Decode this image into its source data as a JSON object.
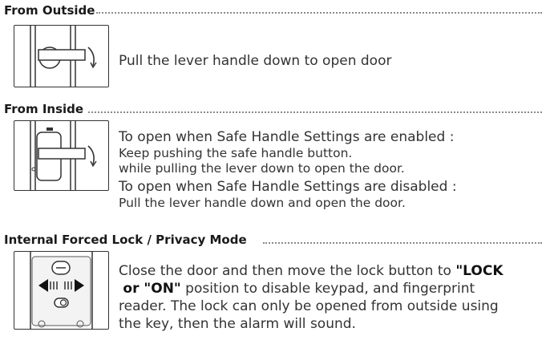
{
  "sections": [
    {
      "heading": "From Outside",
      "lines": [
        "Pull the lever handle down to open door"
      ]
    },
    {
      "heading": "From Inside",
      "lines": [
        "To open when Safe Handle Settings are enabled :",
        "Keep pushing the safe handle button.",
        "while pulling the lever down to open the door.",
        "To open when Safe Handle Settings are disabled :",
        "Pull the lever handle down and open the door."
      ]
    },
    {
      "heading": "Internal Forced Lock / Privacy Mode",
      "lines": {
        "l1_pre": "Close the door and then move the lock button to ",
        "l1_bold": "\"LOCK",
        "l2_bold": "or \"ON\"",
        "l2_post": " position to disable keypad, and fingerprint",
        "l3": "reader. The lock can only be opened from outside using",
        "l4": "the key, then the alarm will sound."
      }
    }
  ]
}
